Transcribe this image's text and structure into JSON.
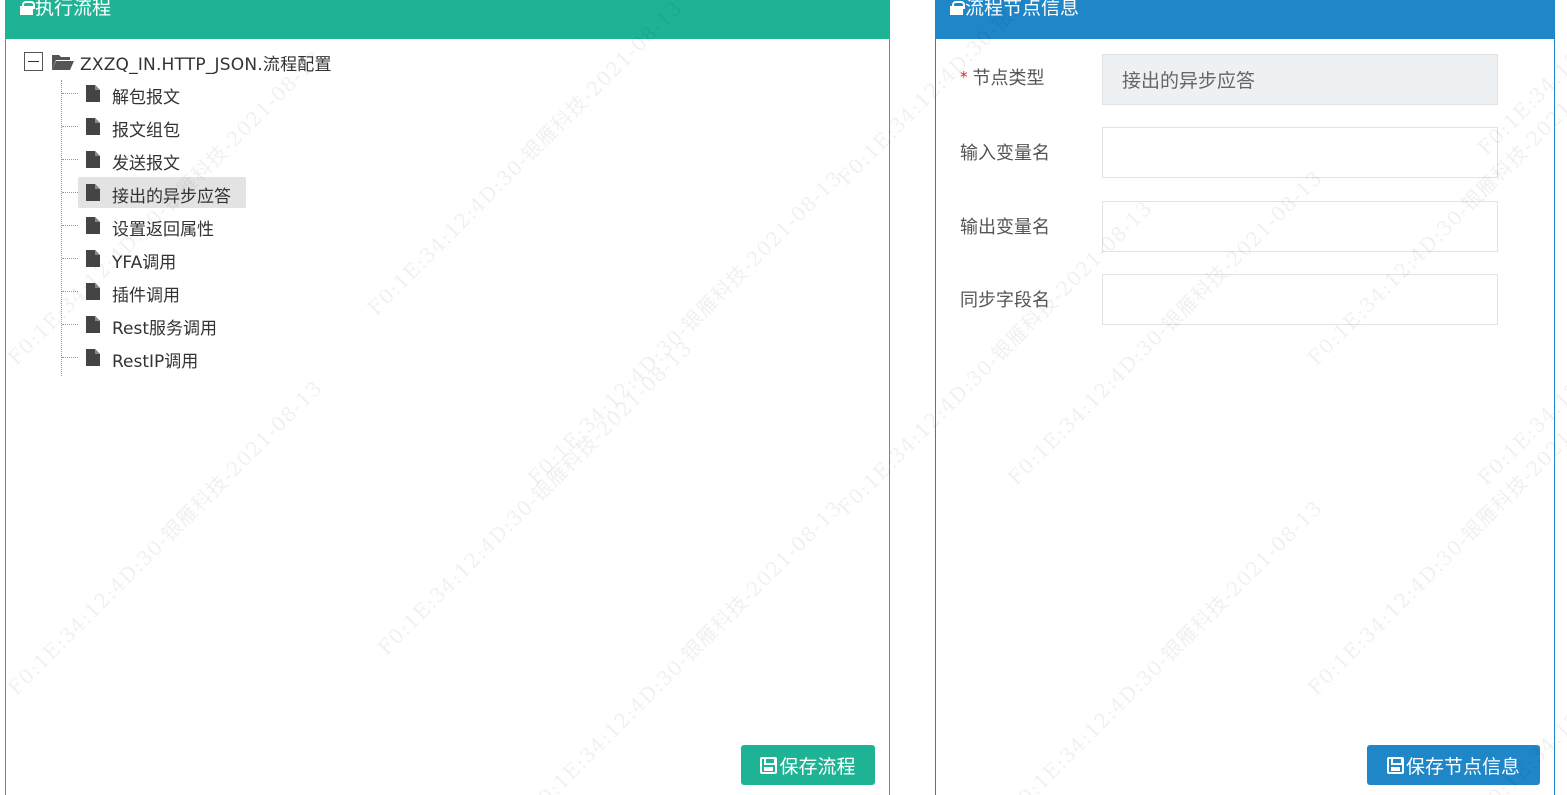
{
  "left_panel": {
    "title": "执行流程",
    "tree": {
      "root_label": "ZXZQ_IN.HTTP_JSON.流程配置",
      "items": [
        {
          "label": "解包报文"
        },
        {
          "label": "报文组包"
        },
        {
          "label": "发送报文"
        },
        {
          "label": "接出的异步应答",
          "selected": true
        },
        {
          "label": "设置返回属性"
        },
        {
          "label": "YFA调用"
        },
        {
          "label": "插件调用"
        },
        {
          "label": "Rest服务调用"
        },
        {
          "label": "RestIP调用"
        }
      ]
    },
    "save_button": "保存流程"
  },
  "right_panel": {
    "title": "流程节点信息",
    "fields": [
      {
        "required_mark": "*",
        "label": "节点类型",
        "value": "接出的异步应答"
      },
      {
        "label": "输入变量名",
        "value": ""
      },
      {
        "label": "输出变量名",
        "value": ""
      },
      {
        "label": "同步字段名",
        "value": ""
      }
    ],
    "save_button": "保存节点信息"
  },
  "watermark": "F0:1E:34:12:4D:30-银雁科技-2021-08-13",
  "colors": {
    "green_accent": "#1fb395",
    "blue_accent": "#1f86c8",
    "selected_bg": "#e3e3e3",
    "required": "#e02020"
  },
  "icons": {
    "header": "gift-icon",
    "root": "folder-open-icon",
    "item": "file-icon",
    "button": "save-icon"
  }
}
